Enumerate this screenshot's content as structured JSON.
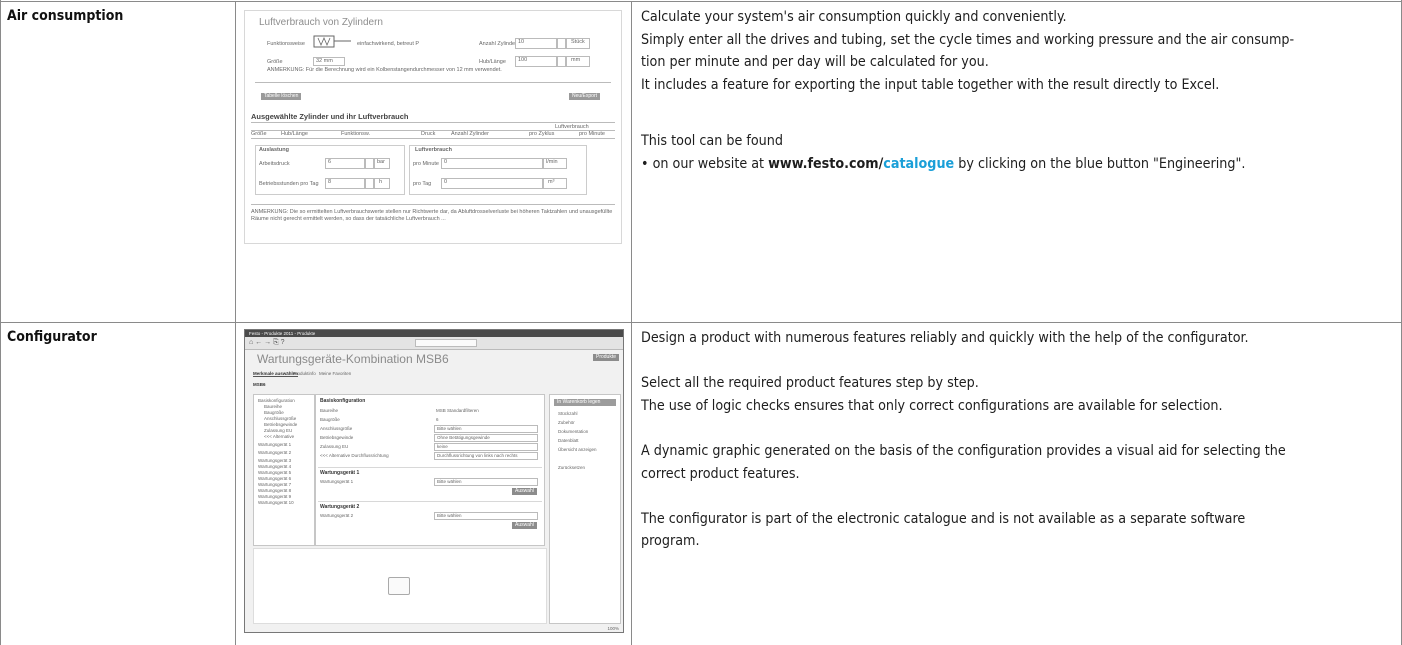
{
  "rows": [
    {
      "label": "Air consumption",
      "screenshot": {
        "title": "Luftverbrauch von Zylindern",
        "funktionsweise_label": "Funktionsweise",
        "funktionsweise_value": "einfachwirkend, betreut P",
        "groesse_label": "Größe",
        "groesse_value": "32 mm",
        "anzahl_label": "Anzahl Zylinder",
        "anzahl_value": "10",
        "hub_label": "Hub/Länge",
        "hub_value": "100",
        "hub_unit": "mm",
        "stueck_unit": "Stück",
        "anmerkung": "ANMERKUNG: Für die Berechnung wird ein Kolbenstangendurchmesser von 12 mm verwendet.",
        "btn_left": "Tabelle löschen",
        "btn_right": "Neu/Export",
        "table_title": "Ausgewählte Zylinder und ihr Luftverbrauch",
        "table_headers": [
          "Größe",
          "Hub/Länge",
          "Funktionsw.",
          "Druck",
          "Anzahl Zylinder",
          "pro Zyklus",
          "pro Minute"
        ],
        "table_group": "Luftverbrauch",
        "auslastung_title": "Auslastung",
        "arbeitsdruck_label": "Arbeitsdruck",
        "arbeitsdruck_value": "6",
        "arbeitsdruck_unit": "bar",
        "betrieb_label": "Betriebsstunden pro Tag",
        "betrieb_value": "8",
        "betrieb_unit": "h",
        "luft_title": "Luftverbrauch",
        "pro_minute_label": "pro Minute",
        "pro_minute_value": "0",
        "pro_minute_unit": "l/min",
        "pro_tag_label": "pro Tag",
        "pro_tag_value": "0",
        "pro_tag_unit": "m³",
        "footer": "ANMERKUNG: Die so ermittelten Luftverbrauchswerte stellen nur Richtwerte dar, da Abluftdrosselverluste bei höheren Taktzahlen und unausgefüllte Räume nicht gerecht ermittelt werden, so dass der tatsächliche Luftverbrauch ..."
      },
      "paragraphs": [
        "Calculate your system's air consumption quickly and conveniently.",
        "Simply enter all the drives and tubing, set the cycle times and working pressure and the air consump-",
        "tion per minute and per day will be calculated for you.",
        "It includes a feature for exporting the input table together with the result directly to Excel."
      ],
      "found": "This tool can be found",
      "bullet_pre": "• on our website at ",
      "bullet_link_a": "www.festo.com/",
      "bullet_link_b": "catalogue",
      "bullet_post": " by clicking on the blue button \"Engineering\"."
    },
    {
      "label": "Configurator",
      "screenshot": {
        "window_title": "Festo - Produkte 2011 - Produkte",
        "heading": "Wartungsgeräte-Kombination MSB6",
        "tabs": [
          "Merkmale auswählen",
          "Produktinfo",
          "Meine Favoriten"
        ],
        "code": "MSB6",
        "section1": "Basiskonfiguration",
        "fields": [
          "Baureihe",
          "Baugröße",
          "Anschlussgröße",
          "Betriebsgewinde",
          "Zulassung EU",
          "<<< Alternative Durchflussrichtung"
        ],
        "values": [
          "MSB Standardfilteren",
          "6",
          "Bitte wählen",
          "Ohne Betätigungsgewinde",
          "keine",
          "Durchflussrichtung von links nach rechts"
        ],
        "section2": "Wartungsgerät 1",
        "section3": "Wartungsgerät 2",
        "wg_field": "Wartungsgerät 1",
        "wg_field2": "Wartungsgerät 2",
        "wg_value": "Bitte wählen",
        "btn": "Auswahl",
        "tree": [
          "Basiskonfiguration",
          "Baureihe",
          "Baugröße",
          "Anschlussgröße",
          "Betriebsgewinde",
          "Zulassung EU",
          "<<< Alternative",
          "Wartungsgerät 1",
          "Wartungsgerät 2",
          "Wartungsgerät 3",
          "Wartungsgerät 4",
          "Wartungsgerät 5",
          "Wartungsgerät 6",
          "Wartungsgerät 7",
          "Wartungsgerät 8",
          "Wartungsgerät 9",
          "Wartungsgerät 10"
        ],
        "side": [
          "In Warenkorb legen",
          "Stückzahl",
          "Zubehör",
          "Dokumentation",
          "Datenblatt",
          "Übersicht anzeigen",
          "Zurücksetzen"
        ],
        "zoom": "100%"
      },
      "paragraphs": [
        "Design a product with numerous features reliably and quickly with the help of the configurator.",
        "",
        "Select all the required product features step by step.",
        "The use of logic checks ensures that only correct configurations are available for selection.",
        "",
        "A dynamic graphic generated on the basis of the configuration provides a visual aid for selecting the",
        "correct product features.",
        "",
        "The configurator is part of the electronic catalogue and is not available as a separate software",
        "program."
      ]
    }
  ]
}
